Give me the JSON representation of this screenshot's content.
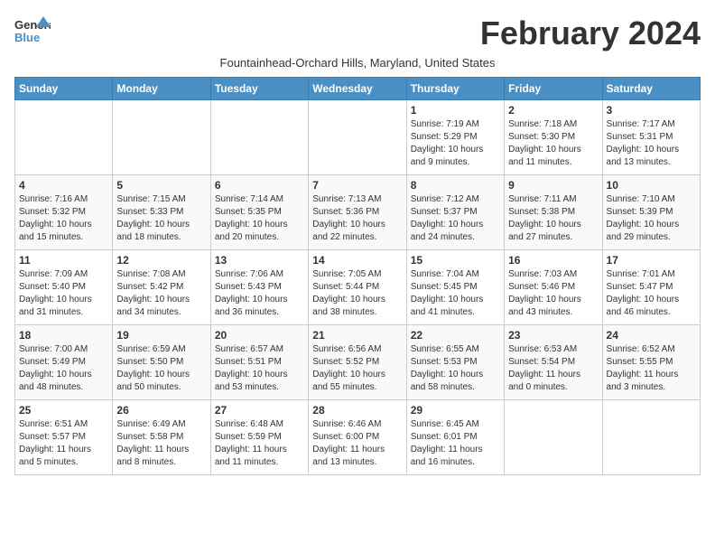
{
  "header": {
    "logo_general": "General",
    "logo_blue": "Blue",
    "month": "February 2024",
    "subtitle": "Fountainhead-Orchard Hills, Maryland, United States"
  },
  "weekdays": [
    "Sunday",
    "Monday",
    "Tuesday",
    "Wednesday",
    "Thursday",
    "Friday",
    "Saturday"
  ],
  "weeks": [
    [
      {
        "day": "",
        "content": ""
      },
      {
        "day": "",
        "content": ""
      },
      {
        "day": "",
        "content": ""
      },
      {
        "day": "",
        "content": ""
      },
      {
        "day": "1",
        "content": "Sunrise: 7:19 AM\nSunset: 5:29 PM\nDaylight: 10 hours\nand 9 minutes."
      },
      {
        "day": "2",
        "content": "Sunrise: 7:18 AM\nSunset: 5:30 PM\nDaylight: 10 hours\nand 11 minutes."
      },
      {
        "day": "3",
        "content": "Sunrise: 7:17 AM\nSunset: 5:31 PM\nDaylight: 10 hours\nand 13 minutes."
      }
    ],
    [
      {
        "day": "4",
        "content": "Sunrise: 7:16 AM\nSunset: 5:32 PM\nDaylight: 10 hours\nand 15 minutes."
      },
      {
        "day": "5",
        "content": "Sunrise: 7:15 AM\nSunset: 5:33 PM\nDaylight: 10 hours\nand 18 minutes."
      },
      {
        "day": "6",
        "content": "Sunrise: 7:14 AM\nSunset: 5:35 PM\nDaylight: 10 hours\nand 20 minutes."
      },
      {
        "day": "7",
        "content": "Sunrise: 7:13 AM\nSunset: 5:36 PM\nDaylight: 10 hours\nand 22 minutes."
      },
      {
        "day": "8",
        "content": "Sunrise: 7:12 AM\nSunset: 5:37 PM\nDaylight: 10 hours\nand 24 minutes."
      },
      {
        "day": "9",
        "content": "Sunrise: 7:11 AM\nSunset: 5:38 PM\nDaylight: 10 hours\nand 27 minutes."
      },
      {
        "day": "10",
        "content": "Sunrise: 7:10 AM\nSunset: 5:39 PM\nDaylight: 10 hours\nand 29 minutes."
      }
    ],
    [
      {
        "day": "11",
        "content": "Sunrise: 7:09 AM\nSunset: 5:40 PM\nDaylight: 10 hours\nand 31 minutes."
      },
      {
        "day": "12",
        "content": "Sunrise: 7:08 AM\nSunset: 5:42 PM\nDaylight: 10 hours\nand 34 minutes."
      },
      {
        "day": "13",
        "content": "Sunrise: 7:06 AM\nSunset: 5:43 PM\nDaylight: 10 hours\nand 36 minutes."
      },
      {
        "day": "14",
        "content": "Sunrise: 7:05 AM\nSunset: 5:44 PM\nDaylight: 10 hours\nand 38 minutes."
      },
      {
        "day": "15",
        "content": "Sunrise: 7:04 AM\nSunset: 5:45 PM\nDaylight: 10 hours\nand 41 minutes."
      },
      {
        "day": "16",
        "content": "Sunrise: 7:03 AM\nSunset: 5:46 PM\nDaylight: 10 hours\nand 43 minutes."
      },
      {
        "day": "17",
        "content": "Sunrise: 7:01 AM\nSunset: 5:47 PM\nDaylight: 10 hours\nand 46 minutes."
      }
    ],
    [
      {
        "day": "18",
        "content": "Sunrise: 7:00 AM\nSunset: 5:49 PM\nDaylight: 10 hours\nand 48 minutes."
      },
      {
        "day": "19",
        "content": "Sunrise: 6:59 AM\nSunset: 5:50 PM\nDaylight: 10 hours\nand 50 minutes."
      },
      {
        "day": "20",
        "content": "Sunrise: 6:57 AM\nSunset: 5:51 PM\nDaylight: 10 hours\nand 53 minutes."
      },
      {
        "day": "21",
        "content": "Sunrise: 6:56 AM\nSunset: 5:52 PM\nDaylight: 10 hours\nand 55 minutes."
      },
      {
        "day": "22",
        "content": "Sunrise: 6:55 AM\nSunset: 5:53 PM\nDaylight: 10 hours\nand 58 minutes."
      },
      {
        "day": "23",
        "content": "Sunrise: 6:53 AM\nSunset: 5:54 PM\nDaylight: 11 hours\nand 0 minutes."
      },
      {
        "day": "24",
        "content": "Sunrise: 6:52 AM\nSunset: 5:55 PM\nDaylight: 11 hours\nand 3 minutes."
      }
    ],
    [
      {
        "day": "25",
        "content": "Sunrise: 6:51 AM\nSunset: 5:57 PM\nDaylight: 11 hours\nand 5 minutes."
      },
      {
        "day": "26",
        "content": "Sunrise: 6:49 AM\nSunset: 5:58 PM\nDaylight: 11 hours\nand 8 minutes."
      },
      {
        "day": "27",
        "content": "Sunrise: 6:48 AM\nSunset: 5:59 PM\nDaylight: 11 hours\nand 11 minutes."
      },
      {
        "day": "28",
        "content": "Sunrise: 6:46 AM\nSunset: 6:00 PM\nDaylight: 11 hours\nand 13 minutes."
      },
      {
        "day": "29",
        "content": "Sunrise: 6:45 AM\nSunset: 6:01 PM\nDaylight: 11 hours\nand 16 minutes."
      },
      {
        "day": "",
        "content": ""
      },
      {
        "day": "",
        "content": ""
      }
    ]
  ]
}
